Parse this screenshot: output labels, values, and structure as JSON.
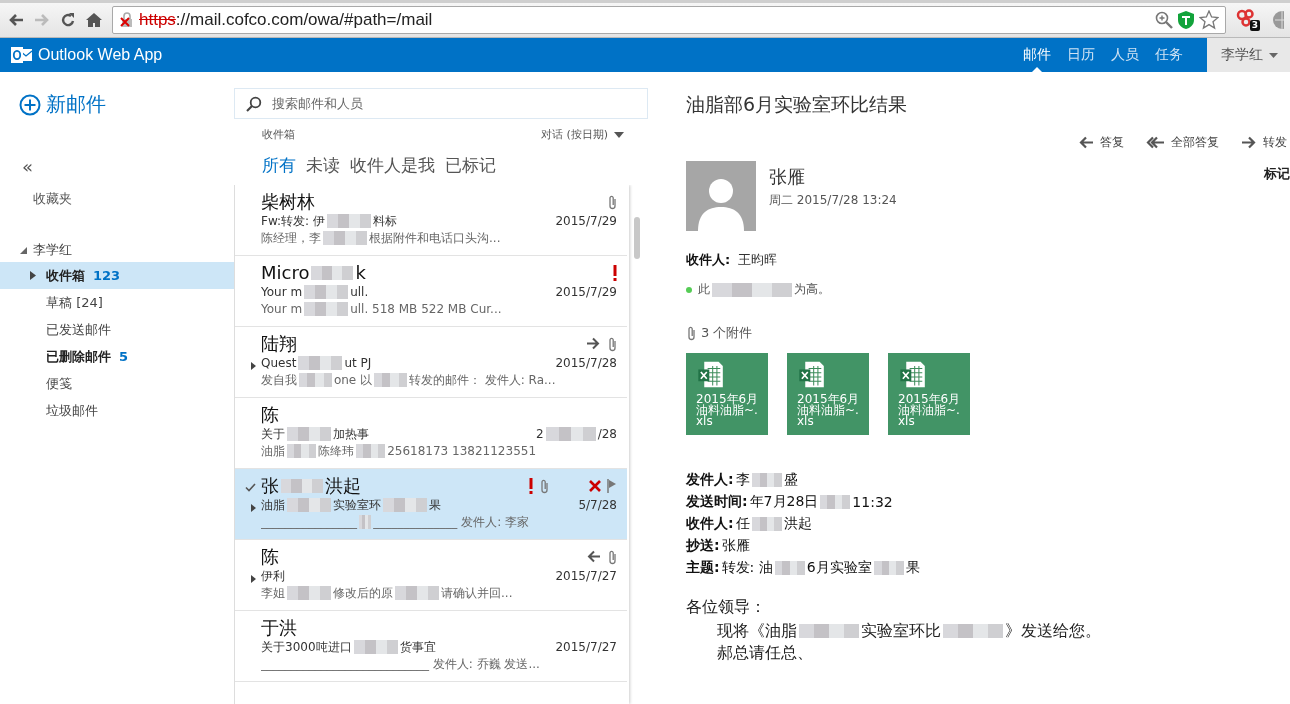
{
  "browser": {
    "url_scheme": "https",
    "url_rest": "://mail.cofco.com/owa/#path=/mail",
    "insecure": true,
    "extension_badge": "3"
  },
  "header": {
    "app_name": "Outlook Web App",
    "nav": [
      {
        "label": "邮件",
        "selected": true
      },
      {
        "label": "日历",
        "selected": false
      },
      {
        "label": "人员",
        "selected": false
      },
      {
        "label": "任务",
        "selected": false
      }
    ],
    "user": "李学红"
  },
  "folder_pane": {
    "new_mail": "新邮件",
    "collapse": "«",
    "favorites": "收藏夹",
    "account": {
      "label": "李学红",
      "expanded": true,
      "children": [
        {
          "label": "收件箱",
          "count": "123",
          "unread": true,
          "selected": true,
          "has_children": true
        },
        {
          "label": "草稿 [24]",
          "unread": false,
          "selected": false,
          "has_children": false
        },
        {
          "label": "已发送邮件",
          "unread": false,
          "selected": false,
          "has_children": false
        },
        {
          "label": "已删除邮件",
          "count": "5",
          "unread": true,
          "selected": false,
          "has_children": false
        },
        {
          "label": "便笺",
          "unread": false,
          "selected": false,
          "has_children": false
        },
        {
          "label": "垃圾邮件",
          "unread": false,
          "selected": false,
          "has_children": false
        }
      ]
    }
  },
  "mail_list": {
    "search": {
      "placeholder": "搜索邮件和人员"
    },
    "folder": "收件箱",
    "sort": "对话 (按日期)",
    "filters": [
      {
        "label": "所有",
        "selected": true
      },
      {
        "label": "未读",
        "selected": false
      },
      {
        "label": "收件人是我",
        "selected": false
      },
      {
        "label": "已标记",
        "selected": false
      }
    ],
    "messages": [
      {
        "sender": [
          "柴树林"
        ],
        "subject": [
          "Fw:转发: 伊",
          "料标"
        ],
        "preview": [
          "陈经理，李",
          "根据附件和电话口头沟..."
        ],
        "date": [
          "2015/7/29"
        ],
        "attachment": true,
        "important": false,
        "forwarded": false,
        "replied": false,
        "thread": false,
        "selected": false
      },
      {
        "sender": [
          "Micro",
          "k"
        ],
        "subject": [
          "Your m",
          "ull."
        ],
        "preview": [
          "Your m",
          "ull.  518 MB 522 MB Cur..."
        ],
        "date": [
          "2015/7/29"
        ],
        "attachment": false,
        "important": true,
        "forwarded": false,
        "replied": false,
        "thread": false,
        "selected": false
      },
      {
        "sender": [
          "陆翔"
        ],
        "subject": [
          "Quest",
          "ut PJ"
        ],
        "preview": [
          "发自我",
          "one  以",
          "转发的邮件：  发件人: Ra..."
        ],
        "date": [
          "2015/7/28"
        ],
        "attachment": true,
        "important": false,
        "forwarded": true,
        "replied": false,
        "thread": true,
        "selected": false
      },
      {
        "sender": [
          "陈"
        ],
        "subject": [
          "关于",
          "加热事"
        ],
        "preview": [
          "油脂",
          "陈绛玮",
          "25618173 13821123551"
        ],
        "date": [
          "2",
          "/28"
        ],
        "attachment": false,
        "important": false,
        "forwarded": false,
        "replied": false,
        "thread": false,
        "selected": false
      },
      {
        "sender": [
          "张",
          "洪起"
        ],
        "subject": [
          "油脂",
          "实验室环",
          "果"
        ],
        "preview": [
          "________________",
          "______________ 发件人: 李家"
        ],
        "date": [
          "5/7/28"
        ],
        "attachment": true,
        "important": true,
        "forwarded": false,
        "replied": false,
        "thread": true,
        "selected": true
      },
      {
        "sender": [
          "陈"
        ],
        "subject": [
          "伊利"
        ],
        "preview": [
          "李姐",
          "修改后的原",
          "请确认并回..."
        ],
        "date": [
          "2015/7/27"
        ],
        "attachment": true,
        "important": false,
        "forwarded": false,
        "replied": true,
        "thread": true,
        "selected": false
      },
      {
        "sender": [
          "于洪"
        ],
        "subject": [
          "关于3000吨进口",
          "货事宜"
        ],
        "preview": [
          "____________________________ 发件人: 乔巍 发送..."
        ],
        "date": [
          "2015/7/27"
        ],
        "attachment": false,
        "important": false,
        "forwarded": false,
        "replied": false,
        "thread": false,
        "selected": false
      }
    ]
  },
  "reading_pane": {
    "title": "油脂部6月实验室环比结果",
    "actions": [
      {
        "label": "答复",
        "kind": "reply"
      },
      {
        "label": "全部答复",
        "kind": "reply_all"
      },
      {
        "label": "转发",
        "kind": "forward"
      }
    ],
    "mark_as": "标记",
    "sender": "张雁",
    "sent": "周二 2015/7/28 13:24",
    "to_label": "收件人:",
    "to": [
      "王昀晖"
    ],
    "importance": [
      "此",
      "为高。"
    ],
    "attachment_count": "3 个附件",
    "attachments": [
      {
        "name": "2015年6月油料油脂~.xls"
      },
      {
        "name": "2015年6月油料油脂~.xls"
      },
      {
        "name": "2015年6月油料油脂~.xls"
      }
    ],
    "forward_header": [
      {
        "label": "发件人:",
        "value": [
          "李",
          "盛"
        ]
      },
      {
        "label": "发送时间:",
        "value": [
          "年7月28日",
          "11:32"
        ]
      },
      {
        "label": "收件人:",
        "value": [
          "任",
          "洪起"
        ]
      },
      {
        "label": "抄送:",
        "value": [
          "张雁"
        ]
      },
      {
        "label": "主题:",
        "value": [
          "转发: 油",
          "6月实验室",
          "果"
        ]
      }
    ],
    "greeting": "各位领导：",
    "body": [
      [
        "现将《油脂",
        "实验室环比",
        "》发送给您。"
      ],
      [
        "郝总请任总、"
      ]
    ]
  }
}
